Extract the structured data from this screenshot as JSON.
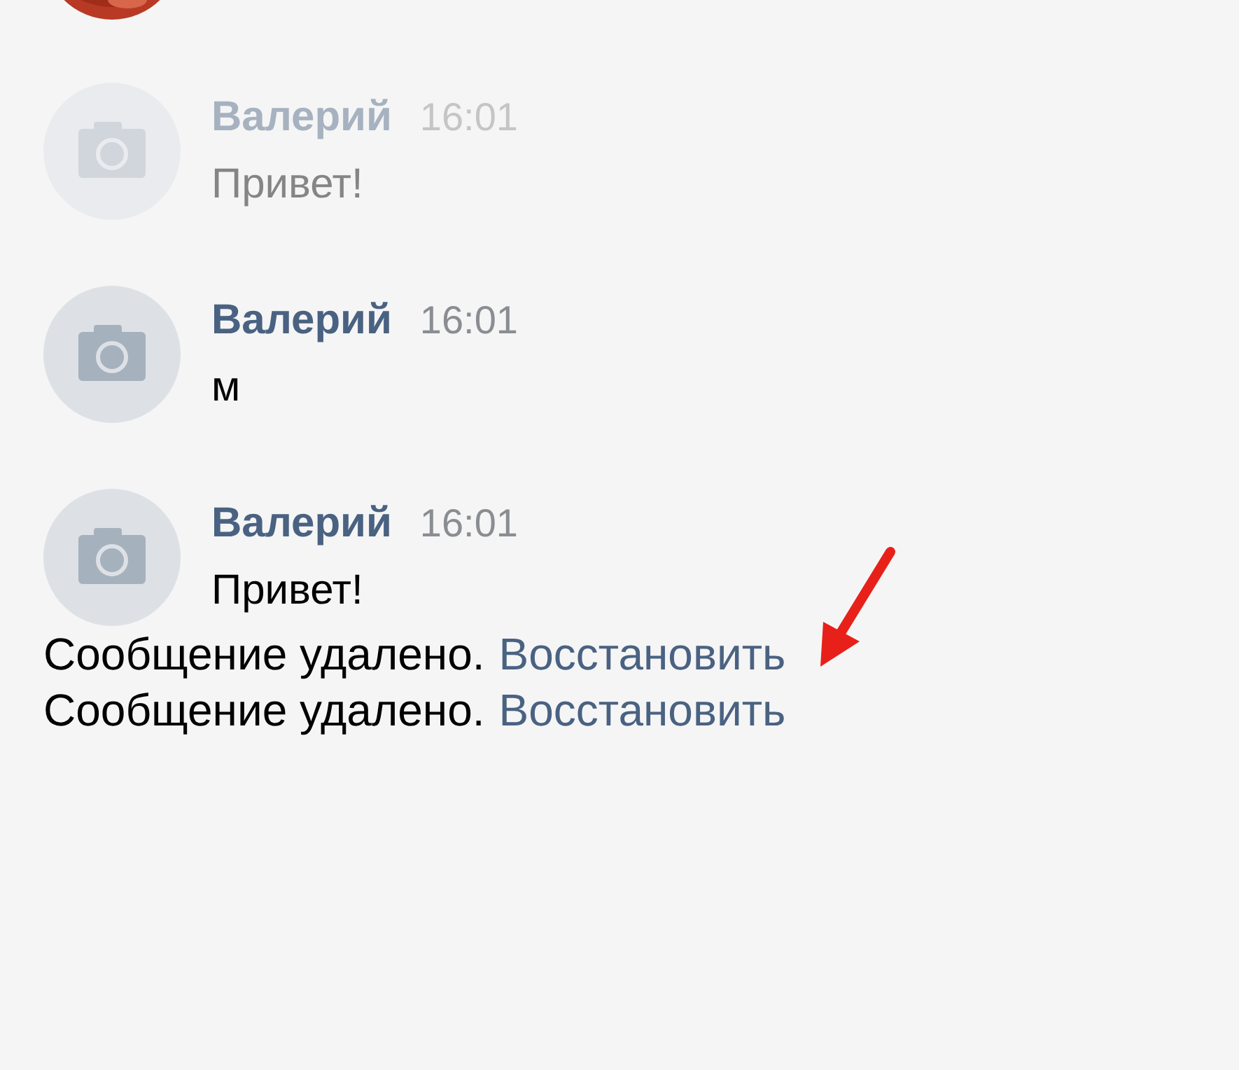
{
  "messages": [
    {
      "kind": "message",
      "author": "Валерий",
      "time": "16:01",
      "text": "Привет!",
      "faded": true
    },
    {
      "kind": "message",
      "author": "Валерий",
      "time": "16:01",
      "text": "м",
      "faded": false
    },
    {
      "kind": "message",
      "author": "Валерий",
      "time": "16:01",
      "text": "Привет!",
      "faded": false
    },
    {
      "kind": "deleted",
      "text": "Сообщение удалено.",
      "action": "Восстановить"
    },
    {
      "kind": "deleted",
      "text": "Сообщение удалено.",
      "action": "Восстановить"
    }
  ]
}
